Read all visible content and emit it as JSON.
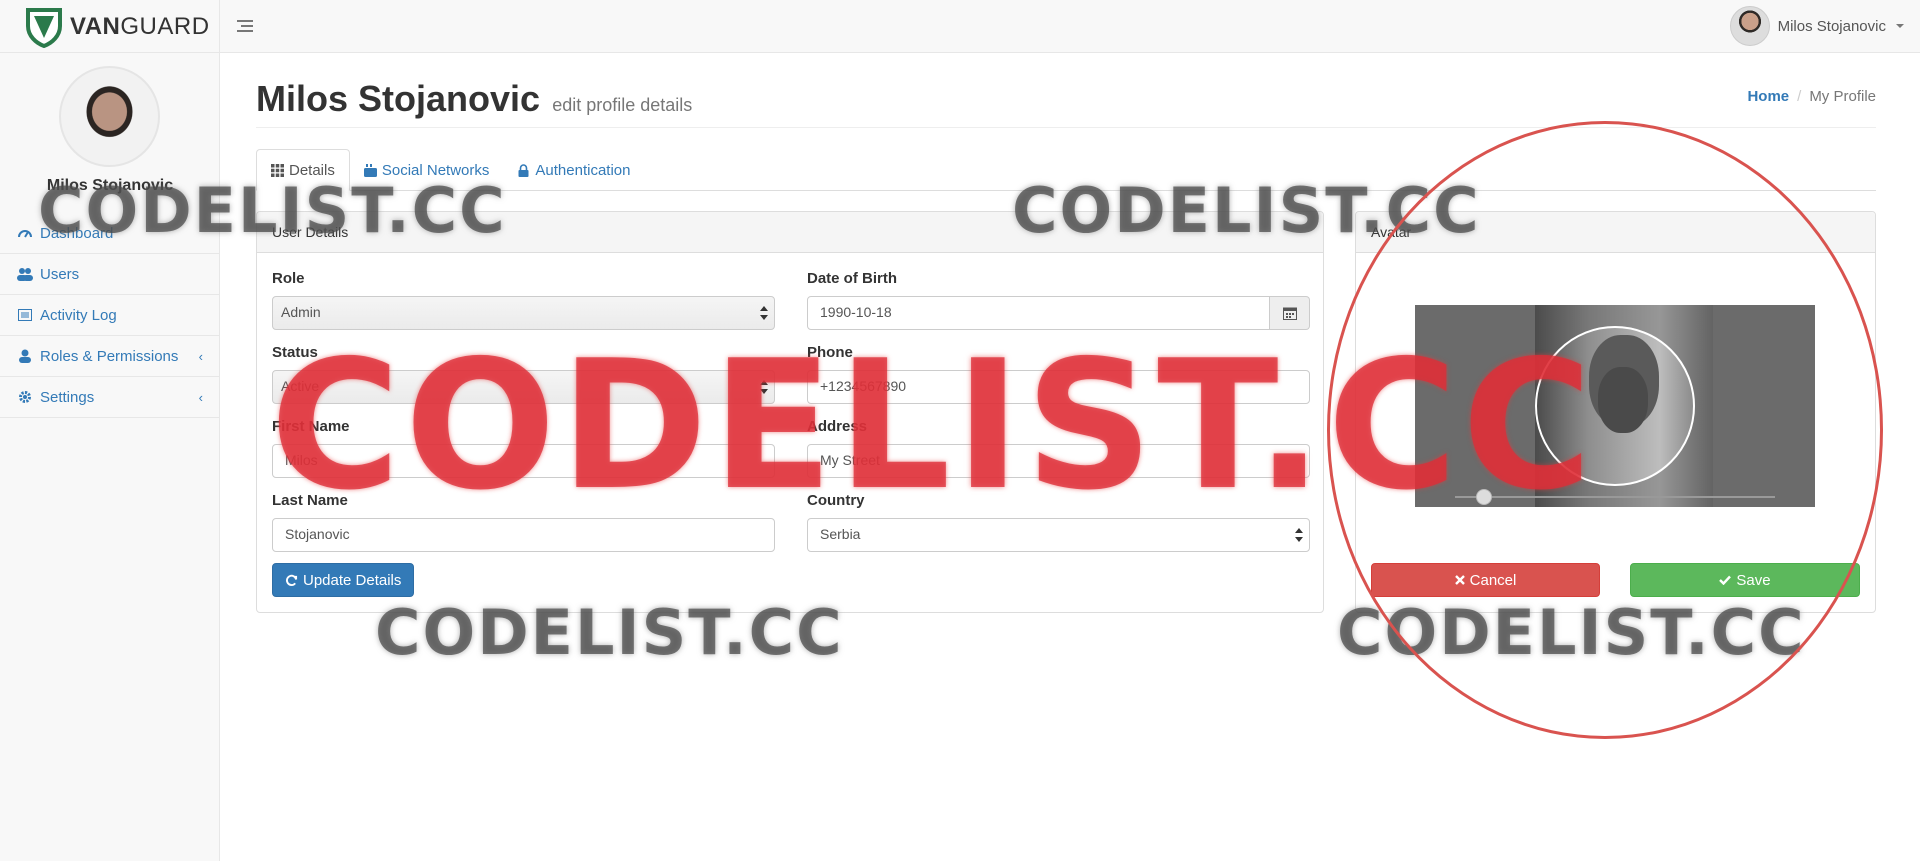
{
  "brand": {
    "name_bold": "VAN",
    "name_rest": "GUARD"
  },
  "topbar": {
    "user_name": "Milos Stojanovic"
  },
  "sidebar": {
    "user_name": "Milos Stojanovic",
    "items": [
      {
        "label": "Dashboard",
        "icon": "dashboard-icon",
        "has_submenu": false
      },
      {
        "label": "Users",
        "icon": "users-icon",
        "has_submenu": false
      },
      {
        "label": "Activity Log",
        "icon": "list-icon",
        "has_submenu": false
      },
      {
        "label": "Roles & Permissions",
        "icon": "user-icon",
        "has_submenu": true
      },
      {
        "label": "Settings",
        "icon": "gear-icon",
        "has_submenu": true
      }
    ]
  },
  "page": {
    "title": "Milos Stojanovic",
    "subtitle": "edit profile details",
    "breadcrumb": {
      "home": "Home",
      "current": "My Profile"
    }
  },
  "tabs": [
    {
      "label": "Details",
      "icon": "grid-icon",
      "active": true
    },
    {
      "label": "Social Networks",
      "icon": "youtube-icon",
      "active": false
    },
    {
      "label": "Authentication",
      "icon": "lock-icon",
      "active": false
    }
  ],
  "details_panel": {
    "heading": "User Details",
    "role": {
      "label": "Role",
      "value": "Admin"
    },
    "dob": {
      "label": "Date of Birth",
      "value": "1990-10-18"
    },
    "status": {
      "label": "Status",
      "value": "Active"
    },
    "phone": {
      "label": "Phone",
      "value": "+1234567890"
    },
    "first_name": {
      "label": "First Name",
      "value": "Milos"
    },
    "address": {
      "label": "Address",
      "value": "My Street"
    },
    "last_name": {
      "label": "Last Name",
      "value": "Stojanovic"
    },
    "country": {
      "label": "Country",
      "value": "Serbia"
    },
    "update_button": "Update Details"
  },
  "avatar_panel": {
    "heading": "Avatar",
    "zoom_level": 0.07,
    "cancel_button": "Cancel",
    "save_button": "Save"
  },
  "watermarks": {
    "text": "CODELIST.CC"
  },
  "colors": {
    "link": "#337ab7",
    "primary": "#337ab7",
    "danger": "#d9534f",
    "success": "#5cb85c",
    "annotation_circle": "#d9534f",
    "watermark_red": "#de2d37"
  }
}
